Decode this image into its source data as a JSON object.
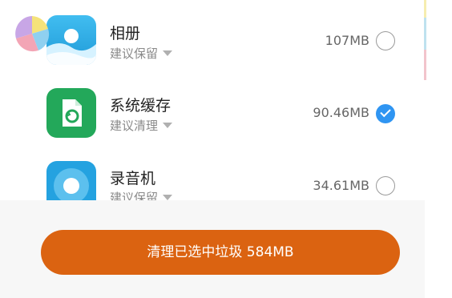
{
  "items": [
    {
      "name": "相册",
      "suggestion": "建议保留",
      "size": "107MB",
      "checked": false,
      "icon": "gallery-icon"
    },
    {
      "name": "系统缓存",
      "suggestion": "建议清理",
      "size": "90.46MB",
      "checked": true,
      "icon": "system-cache-icon"
    },
    {
      "name": "录音机",
      "suggestion": "建议保留",
      "size": "34.61MB",
      "checked": false,
      "icon": "recorder-icon"
    }
  ],
  "clean_button": {
    "label": "清理已选中垃圾 584MB"
  },
  "colors": {
    "accent": "#db6311",
    "check_blue": "#2f95f2",
    "gallery_blue": "#2aa7e0",
    "cache_green": "#23a85a",
    "recorder_blue": "#24a2e0"
  }
}
